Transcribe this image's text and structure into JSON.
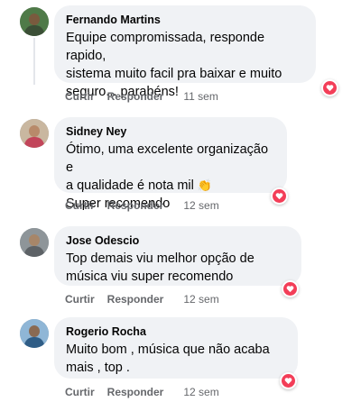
{
  "comments": [
    {
      "author": "Fernando Martins",
      "lines": [
        "Equipe compromissada, responde rapido,",
        "sistema muito facil pra baixar e muito",
        "seguro... parabéns!"
      ],
      "like_label": "Curtir",
      "reply_label": "Responder",
      "time": "11 sem",
      "reaction_icon": "heart-icon",
      "avatar_colors": {
        "bg": "#4f7a48",
        "head": "#7a5a3e",
        "body": "#3b4f36"
      }
    },
    {
      "author": "Sidney Ney",
      "lines": [
        "Ótimo, uma excelente organização e",
        "a qualidade é nota mil",
        "Super recomendo"
      ],
      "emoji": "👏",
      "like_label": "Curtir",
      "reply_label": "Responder",
      "time": "12 sem",
      "reaction_icon": "heart-icon",
      "avatar_colors": {
        "bg": "#c9b7a0",
        "head": "#b88a6a",
        "body": "#c2455a"
      }
    },
    {
      "author": "Jose Odescio",
      "lines": [
        "Top demais viu melhor opção de",
        "música viu super recomendo"
      ],
      "like_label": "Curtir",
      "reply_label": "Responder",
      "time": "12 sem",
      "reaction_icon": "heart-icon",
      "avatar_colors": {
        "bg": "#8e9599",
        "head": "#a78669",
        "body": "#5d6266"
      }
    },
    {
      "author": "Rogerio Rocha",
      "lines": [
        "Muito bom , música que não acaba",
        "mais , top ."
      ],
      "like_label": "Curtir",
      "reply_label": "Responder",
      "time": "12 sem",
      "reaction_icon": "heart-icon",
      "avatar_colors": {
        "bg": "#8fb6d6",
        "head": "#8a6a52",
        "body": "#2f5d86"
      }
    }
  ],
  "colors": {
    "bubble": "#f0f2f5",
    "meta_text": "#65676b",
    "heart": "#f33e58"
  }
}
